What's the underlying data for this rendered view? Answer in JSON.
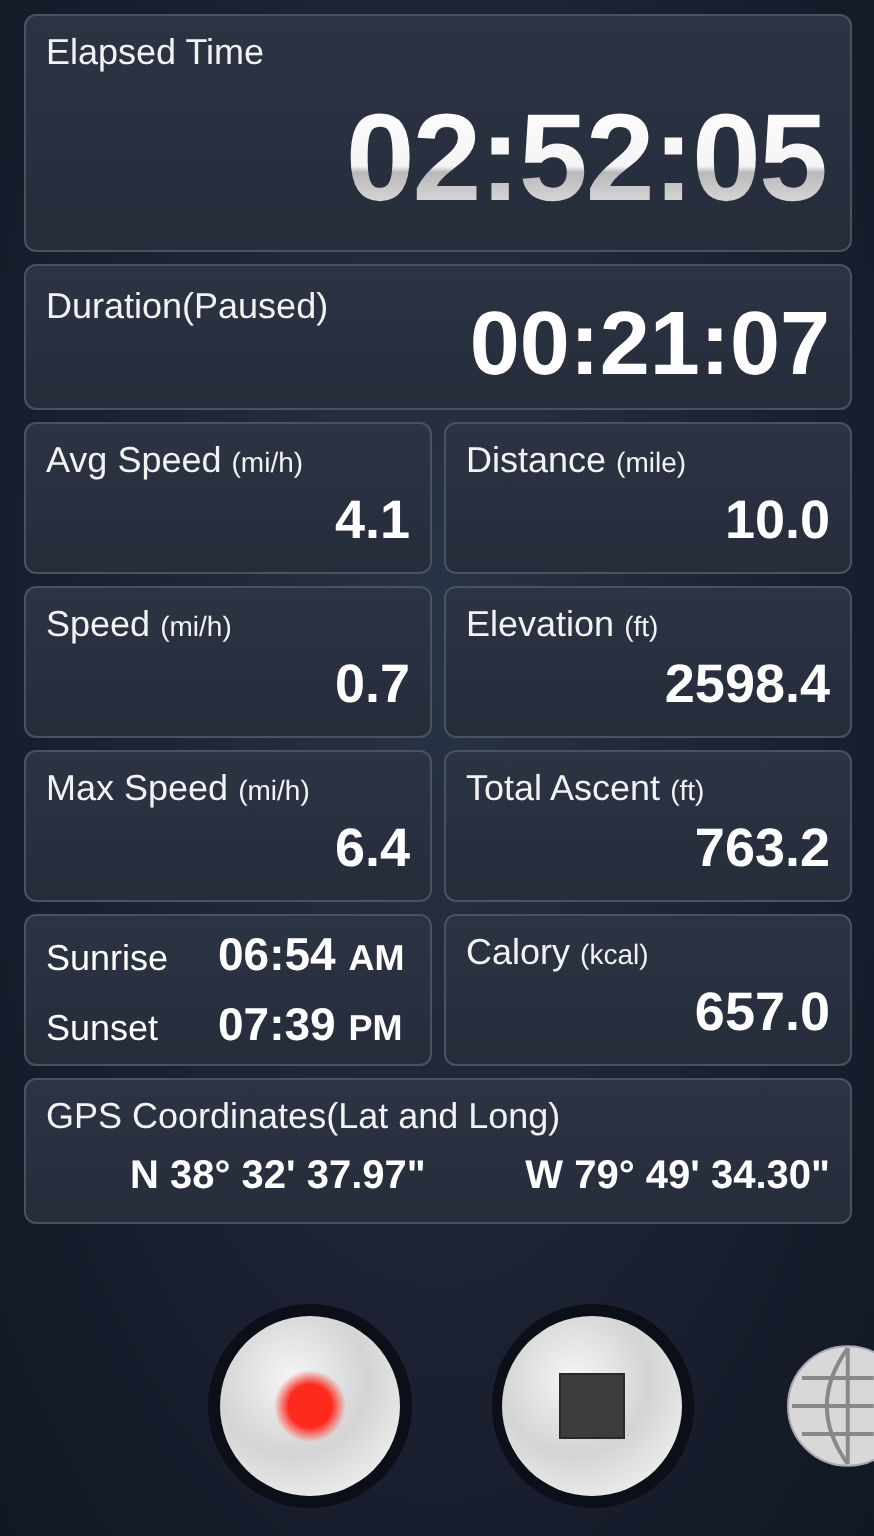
{
  "elapsed": {
    "label": "Elapsed Time",
    "value": "02:52:05"
  },
  "duration": {
    "label": "Duration(Paused)",
    "value": "00:21:07"
  },
  "tiles": [
    {
      "kind": "stat",
      "label": "Avg Speed",
      "unit": "(mi/h)",
      "value": "4.1"
    },
    {
      "kind": "stat",
      "label": "Distance",
      "unit": "(mile)",
      "value": "10.0"
    },
    {
      "kind": "stat",
      "label": "Speed",
      "unit": "(mi/h)",
      "value": "0.7"
    },
    {
      "kind": "stat",
      "label": "Elevation",
      "unit": "(ft)",
      "value": "2598.4"
    },
    {
      "kind": "stat",
      "label": "Max Speed",
      "unit": "(mi/h)",
      "value": "6.4"
    },
    {
      "kind": "stat",
      "label": "Total Ascent",
      "unit": "(ft)",
      "value": "763.2"
    },
    {
      "kind": "sun",
      "rows": [
        {
          "label": "Sunrise",
          "time": "06:54",
          "ampm": "AM"
        },
        {
          "label": "Sunset",
          "time": "07:39",
          "ampm": "PM"
        }
      ]
    },
    {
      "kind": "stat",
      "label": "Calory",
      "unit": "(kcal)",
      "value": "657.0"
    }
  ],
  "gps": {
    "label": "GPS Coordinates(Lat and Long)",
    "lat": "N 38° 32' 37.97\"",
    "long": "W 79° 49' 34.30\""
  }
}
